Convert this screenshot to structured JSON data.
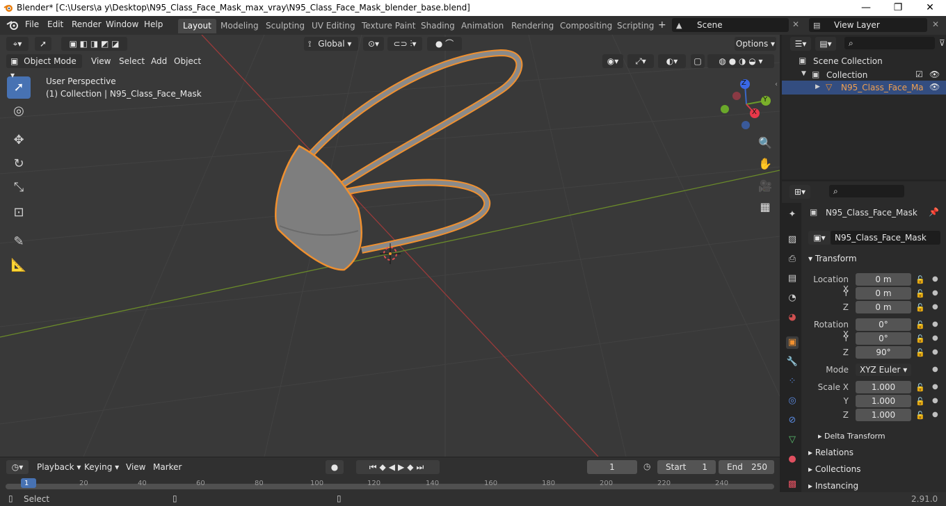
{
  "window": {
    "title": "Blender* [C:\\Users\\a y\\Desktop\\N95_Class_Face_Mask_max_vray\\N95_Class_Face_Mask_blender_base.blend]",
    "minimize": "—",
    "maximize": "❐",
    "close": "✕"
  },
  "menus": [
    "File",
    "Edit",
    "Render",
    "Window",
    "Help"
  ],
  "workspaces": [
    "Layout",
    "Modeling",
    "Sculpting",
    "UV Editing",
    "Texture Paint",
    "Shading",
    "Animation",
    "Rendering",
    "Compositing",
    "Scripting"
  ],
  "active_workspace": "Layout",
  "scene": {
    "name": "Scene",
    "view_layer": "View Layer"
  },
  "viewport": {
    "mode": "Object Mode",
    "menus": [
      "View",
      "Select",
      "Add",
      "Object"
    ],
    "orientation": "Global",
    "options": "Options",
    "perspective": "User Perspective",
    "collection_info": "(1) Collection | N95_Class_Face_Mask",
    "gizmo": {
      "x": "X",
      "y": "Y",
      "z": "Z"
    }
  },
  "outliner": {
    "root": "Scene Collection",
    "collection": "Collection",
    "object": "N95_Class_Face_Ma"
  },
  "properties": {
    "object_name": "N95_Class_Face_Mask",
    "data_name": "N95_Class_Face_Mask",
    "transform_header": "Transform",
    "location_label": "Location X",
    "rotation_label": "Rotation X",
    "scale_label": "Scale X",
    "y": "Y",
    "z": "Z",
    "location": [
      "0 m",
      "0 m",
      "0 m"
    ],
    "rotation": [
      "0°",
      "0°",
      "90°"
    ],
    "mode_label": "Mode",
    "mode_value": "XYZ Euler",
    "scale": [
      "1.000",
      "1.000",
      "1.000"
    ],
    "delta": "Delta Transform",
    "relations": "Relations",
    "collections": "Collections",
    "instancing": "Instancing"
  },
  "timeline": {
    "menus": [
      "Playback",
      "Keying",
      "View",
      "Marker"
    ],
    "current_frame": "1",
    "start_label": "Start",
    "start": "1",
    "end_label": "End",
    "end": "250",
    "ticks": [
      "1",
      "20",
      "40",
      "60",
      "80",
      "100",
      "120",
      "140",
      "160",
      "180",
      "200",
      "220",
      "240"
    ]
  },
  "status": {
    "left": "Select",
    "version": "2.91.0"
  },
  "colors": {
    "accent": "#4772b3",
    "selection_outline": "#f0902f",
    "x_axis": "#9a3a3a",
    "y_axis": "#6a8a2a"
  }
}
